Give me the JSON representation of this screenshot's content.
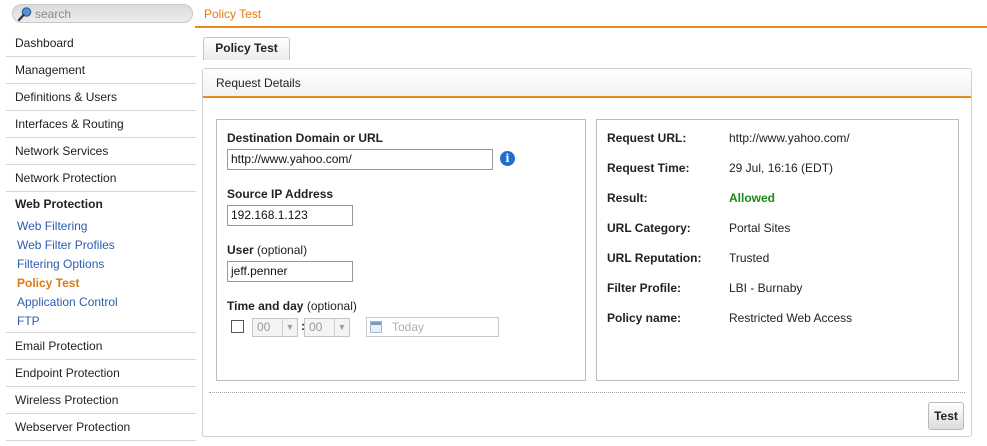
{
  "search": {
    "placeholder": "search"
  },
  "breadcrumb": "Policy Test",
  "sidebar": {
    "items_top": [
      "Dashboard",
      "Management",
      "Definitions & Users",
      "Interfaces & Routing",
      "Network Services",
      "Network Protection"
    ],
    "group": {
      "title": "Web Protection",
      "items": [
        "Web Filtering",
        "Web Filter Profiles",
        "Filtering Options",
        "Policy Test",
        "Application Control",
        "FTP"
      ],
      "active": "Policy Test"
    },
    "items_bottom": [
      "Email Protection",
      "Endpoint Protection",
      "Wireless Protection",
      "Webserver Protection"
    ]
  },
  "tab": "Policy Test",
  "panel": {
    "title": "Request Details"
  },
  "form": {
    "dest_label": "Destination Domain or URL",
    "dest_value": "http://www.yahoo.com/",
    "info_glyph": "i",
    "src_label": "Source IP Address",
    "src_value": "192.168.1.123",
    "user_label": "User",
    "user_optional": "(optional)",
    "user_value": "jeff.penner",
    "time_label": "Time and day",
    "time_optional": "(optional)",
    "hour": "00",
    "minute": "00",
    "colon": ":",
    "date_placeholder": "Today"
  },
  "result": {
    "rows": [
      {
        "key": "Request URL:",
        "value": "http://www.yahoo.com/"
      },
      {
        "key": "Request Time:",
        "value": "29 Jul, 16:16 (EDT)"
      },
      {
        "key": "Result:",
        "value": "Allowed"
      },
      {
        "key": "URL Category:",
        "value": "Portal Sites"
      },
      {
        "key": "URL Reputation:",
        "value": "Trusted"
      },
      {
        "key": "Filter Profile:",
        "value": "LBI - Burnaby"
      },
      {
        "key": "Policy name:",
        "value": "Restricted Web Access"
      }
    ]
  },
  "buttons": {
    "test": "Test"
  },
  "colors": {
    "accent": "#e8891d",
    "link": "#2a5db0",
    "allowed": "#1a8a1a",
    "info": "#1f6fd0"
  }
}
